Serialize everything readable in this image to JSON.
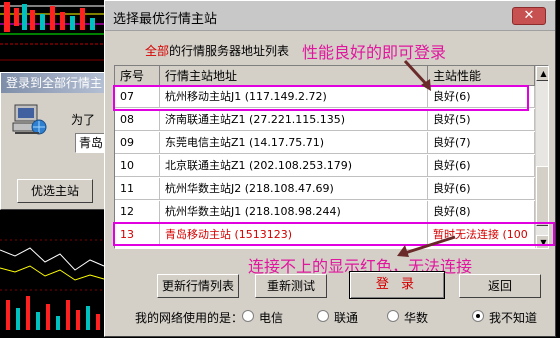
{
  "back_dialog": {
    "title": "登录到全部行情主",
    "prompt": "为了",
    "input_value": "青岛",
    "preferred_button": "优选主站"
  },
  "dialog": {
    "title": "选择最优行情主站",
    "close_glyph": "✕",
    "caption_red": "全部",
    "caption_rest": "的行情服务器地址列表",
    "annotation_top": "性能良好的即可登录",
    "annotation_bottom": "连接不上的显示红色，无法连接"
  },
  "table": {
    "headers": [
      "序号",
      "行情主站地址",
      "主站性能"
    ],
    "rows": [
      {
        "no": "07",
        "address": "杭州移动主站J1 (117.149.2.72)",
        "status": "良好(6)",
        "error": false
      },
      {
        "no": "08",
        "address": "济南联通主站Z1 (27.221.115.135)",
        "status": "良好(5)",
        "error": false
      },
      {
        "no": "09",
        "address": "东莞电信主站Z1 (14.17.75.71)",
        "status": "良好(7)",
        "error": false
      },
      {
        "no": "10",
        "address": "北京联通主站Z1 (202.108.253.179)",
        "status": "良好(6)",
        "error": false
      },
      {
        "no": "11",
        "address": "杭州华数主站J2 (218.108.47.69)",
        "status": "良好(6)",
        "error": false
      },
      {
        "no": "12",
        "address": "杭州华数主站J1 (218.108.98.244)",
        "status": "良好(8)",
        "error": false
      },
      {
        "no": "13",
        "address": "青岛移动主站 (1513123)",
        "status": "暂时无法连接 (100",
        "error": true
      }
    ]
  },
  "buttons": {
    "update_list": "更新行情列表",
    "retest": "重新测试",
    "login": "登 录",
    "back": "返回"
  },
  "network": {
    "label": "我的网络使用的是：",
    "options": [
      "电信",
      "联通",
      "华数",
      "我不知道"
    ],
    "selected": "我不知道"
  },
  "colors": {
    "error_red": "#d40000",
    "highlight_magenta": "#e000e0",
    "annotation_pink": "#e0179e"
  }
}
